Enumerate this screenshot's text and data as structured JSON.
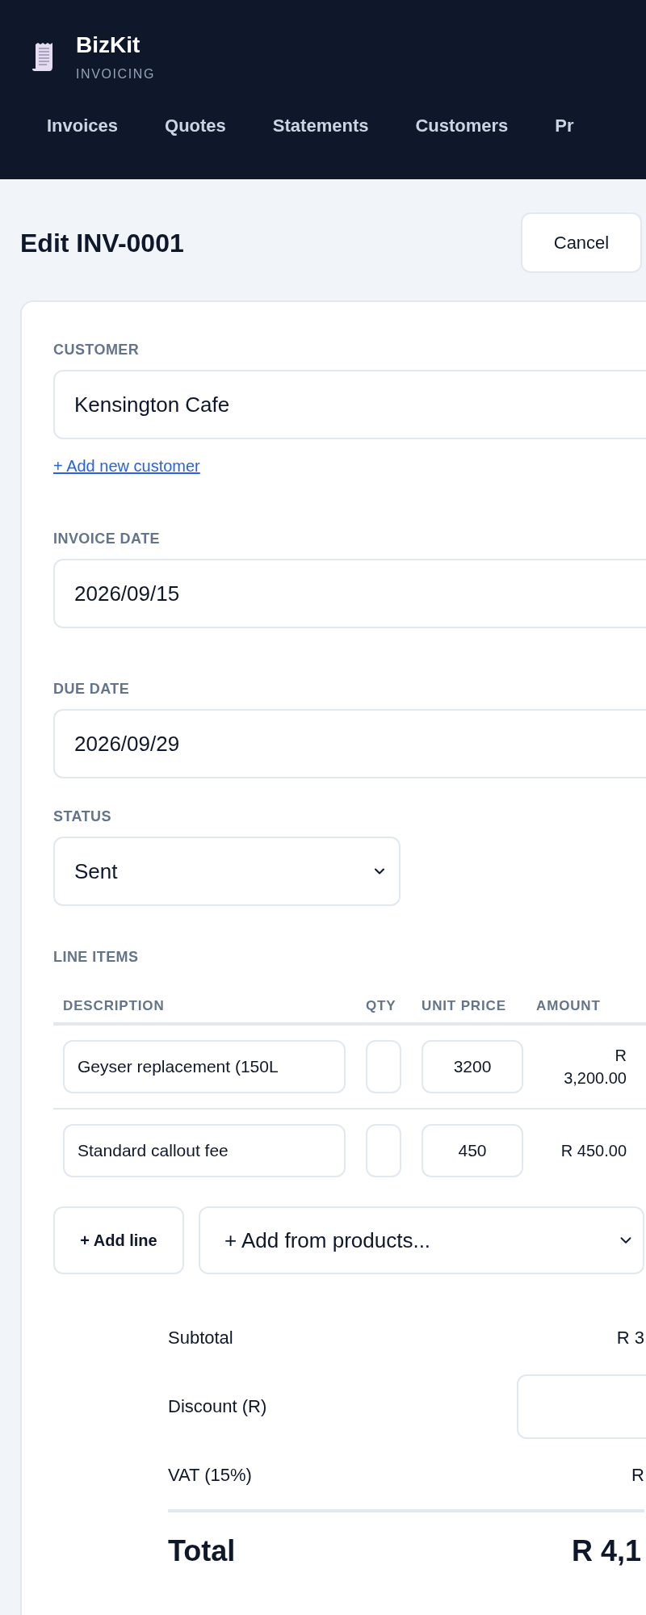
{
  "app": {
    "name": "BizKit",
    "subtitle": "INVOICING"
  },
  "nav": [
    {
      "label": "Invoices"
    },
    {
      "label": "Quotes"
    },
    {
      "label": "Statements"
    },
    {
      "label": "Customers"
    },
    {
      "label": "Pr"
    }
  ],
  "page": {
    "title": "Edit INV-0001",
    "cancel_button": "Cancel"
  },
  "form": {
    "customer": {
      "label": "CUSTOMER",
      "value": "Kensington Cafe",
      "add_link": "+ Add new customer"
    },
    "invoice_date": {
      "label": "INVOICE DATE",
      "value": "2026/09/15"
    },
    "due_date": {
      "label": "DUE DATE",
      "value": "2026/09/29"
    },
    "status": {
      "label": "STATUS",
      "value": "Sent"
    }
  },
  "line_items": {
    "label": "LINE ITEMS",
    "columns": [
      "DESCRIPTION",
      "QTY",
      "UNIT PRICE",
      "AMOUNT"
    ],
    "rows": [
      {
        "description": "Geyser replacement (150L",
        "unit_price": "3200",
        "amount": "R 3,200.00"
      },
      {
        "description": "Standard callout fee",
        "unit_price": "450",
        "amount": "R 450.00"
      }
    ],
    "add_line_button": "+ Add line",
    "add_from_products": "+ Add from products..."
  },
  "totals": [
    {
      "kind": "text",
      "label": "Subtotal",
      "value": "R 3"
    },
    {
      "kind": "input",
      "label": "Discount (R)"
    },
    {
      "kind": "text",
      "label": "VAT (15%)",
      "value": "R"
    }
  ],
  "total": {
    "label": "Total",
    "value": "R 4,1"
  }
}
